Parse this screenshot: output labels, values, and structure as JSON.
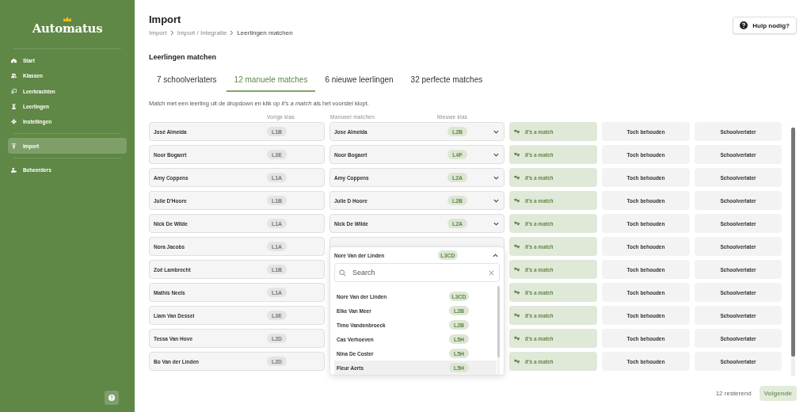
{
  "sidebar": {
    "logo": "Automatus",
    "groups": [
      [
        {
          "label": "Start",
          "selected": false
        },
        {
          "label": "Klassen",
          "selected": false
        },
        {
          "label": "Leerkrachten",
          "selected": false
        },
        {
          "label": "Leerlingen",
          "selected": false
        },
        {
          "label": "Instellingen",
          "selected": false
        }
      ],
      [
        {
          "label": "Import",
          "selected": true
        }
      ],
      [
        {
          "label": "Beheerders",
          "selected": false
        }
      ]
    ]
  },
  "header": {
    "title": "Import",
    "breadcrumb": [
      "Import",
      "Import / Integratie",
      "Leerlingen matchen"
    ],
    "help_button": "Hulp nodig?"
  },
  "section_title": "Leerlingen matchen",
  "tabs": [
    {
      "label": "7 schoolverlaters",
      "selected": false
    },
    {
      "label": "12 manuele matches",
      "selected": true
    },
    {
      "label": "6 nieuwe leerlingen",
      "selected": false
    },
    {
      "label": "32 perfecte matches",
      "selected": false
    }
  ],
  "instruction": "Match met een leerling uit de dropdown en klik op *It's a match* als het voorstel klopt.",
  "columns": [
    "Vorige klas",
    "Manueel matchen",
    "Nieuwe klas"
  ],
  "rows": [
    {
      "name": "José Almeida",
      "prev_class": "L1B",
      "match": {
        "name": "Jose Almeida",
        "class": "L2B"
      },
      "actions": [
        "It's a match",
        "Toch behouden",
        "Schoolverlater"
      ]
    },
    {
      "name": "Noor Bogaert",
      "prev_class": "L3E",
      "match": {
        "name": "Noor Bogaert",
        "class": "L4F"
      },
      "actions": [
        "It's a match",
        "Toch behouden",
        "Schoolverlater"
      ]
    },
    {
      "name": "Amy Coppens",
      "prev_class": "L1A",
      "match": {
        "name": "Amy Coppens",
        "class": "L2A"
      },
      "actions": [
        "It's a match",
        "Toch behouden",
        "Schoolverlater"
      ]
    },
    {
      "name": "Julie D'Hoore",
      "prev_class": "L1B",
      "match": {
        "name": "Julie D Hoore",
        "class": "L2B"
      },
      "actions": [
        "It's a match",
        "Toch behouden",
        "Schoolverlater"
      ]
    },
    {
      "name": "Nick De Wilde",
      "prev_class": "L1A",
      "match": {
        "name": "Nick De Wilde",
        "class": "L2A"
      },
      "actions": [
        "It's a match",
        "Toch behouden",
        "Schoolverlater"
      ]
    },
    {
      "name": "Nora Jacobs",
      "prev_class": "L1A",
      "dropdown": {
        "selected_name": "Nore Van der Linden",
        "selected_class": "L3CD",
        "search_placeholder": "Search",
        "options": [
          {
            "name": "Nore Van der Linden",
            "class": "L3CD",
            "selected": false
          },
          {
            "name": "Elke Van Meer",
            "class": "L2B",
            "selected": false
          },
          {
            "name": "Timo Vandenbroeck",
            "class": "L2B",
            "selected": false
          },
          {
            "name": "Cas Verhoeven",
            "class": "L5H",
            "selected": false
          },
          {
            "name": "Nina De Coster",
            "class": "L5H",
            "selected": false
          },
          {
            "name": "Fleur Aerts",
            "class": "L5H",
            "selected": true
          }
        ]
      },
      "actions": [
        "It's a match",
        "Toch behouden",
        "Schoolverlater"
      ]
    },
    {
      "name": "Zoë Lambrecht",
      "prev_class": "L1B",
      "actions": [
        "It's a match",
        "Toch behouden",
        "Schoolverlater"
      ]
    },
    {
      "name": "Mathis Neels",
      "prev_class": "L1A",
      "actions": [
        "It's a match",
        "Toch behouden",
        "Schoolverlater"
      ]
    },
    {
      "name": "Liam Van Dessel",
      "prev_class": "L3E",
      "actions": [
        "It's a match",
        "Toch behouden",
        "Schoolverlater"
      ]
    },
    {
      "name": "Tessa Van Hove",
      "prev_class": "L2D",
      "actions": [
        "It's a match",
        "Toch behouden",
        "Schoolverlater"
      ]
    },
    {
      "name": "Bo Van der Linden",
      "prev_class": "L2D",
      "actions": [
        "It's a match",
        "Toch behouden",
        "Schoolverlater"
      ]
    }
  ],
  "footer": {
    "remaining": "12 resterend",
    "next_button": {
      "label": "Volgende",
      "disabled": true
    }
  }
}
